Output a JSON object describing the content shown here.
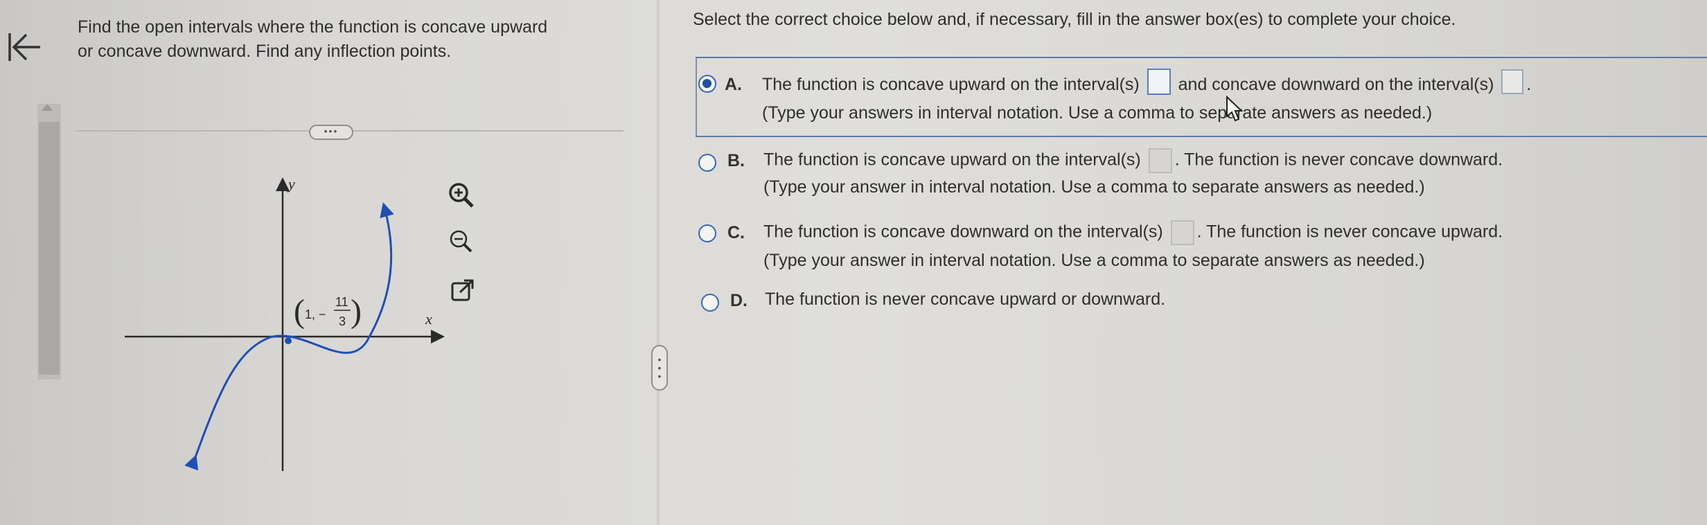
{
  "question": {
    "line1": "Find the open intervals where the function is concave upward",
    "line2": "or concave downward. Find any inflection points."
  },
  "graph": {
    "y_label": "y",
    "x_label": "x",
    "point_prefix": "1, −",
    "point_num": "11",
    "point_den": "3",
    "curve_color": "#1f4fb5"
  },
  "toolbar": {
    "zoom_in_icon": "zoom-in-icon",
    "zoom_out_icon": "zoom-out-icon",
    "popout_icon": "external-link-icon"
  },
  "expand_label": "•••",
  "instruction": "Select the correct choice below and, if necessary, fill in the answer box(es) to complete your choice.",
  "choices": [
    {
      "letter": "A.",
      "selected": true,
      "line1_a": "The function is concave upward on the interval(s)",
      "line1_b": "and concave downward on the interval(s)",
      "line1_c": ".",
      "line2": "(Type your answers in interval notation. Use a comma to separate answers as needed.)"
    },
    {
      "letter": "B.",
      "selected": false,
      "line1_a": "The function is concave upward on the interval(s)",
      "line1_b": ". The function is never concave downward.",
      "line2": "(Type your answer in interval notation. Use a comma to separate answers as needed.)"
    },
    {
      "letter": "C.",
      "selected": false,
      "line1_a": "The function is concave downward on the interval(s)",
      "line1_b": ". The function is never concave upward.",
      "line2": "(Type your answer in interval notation. Use a comma to separate answers as needed.)"
    },
    {
      "letter": "D.",
      "selected": false,
      "line1_a": "The function is never concave upward or downward."
    }
  ],
  "colors": {
    "accent": "#3a67b5",
    "selection_border": "#5e7aa8"
  }
}
